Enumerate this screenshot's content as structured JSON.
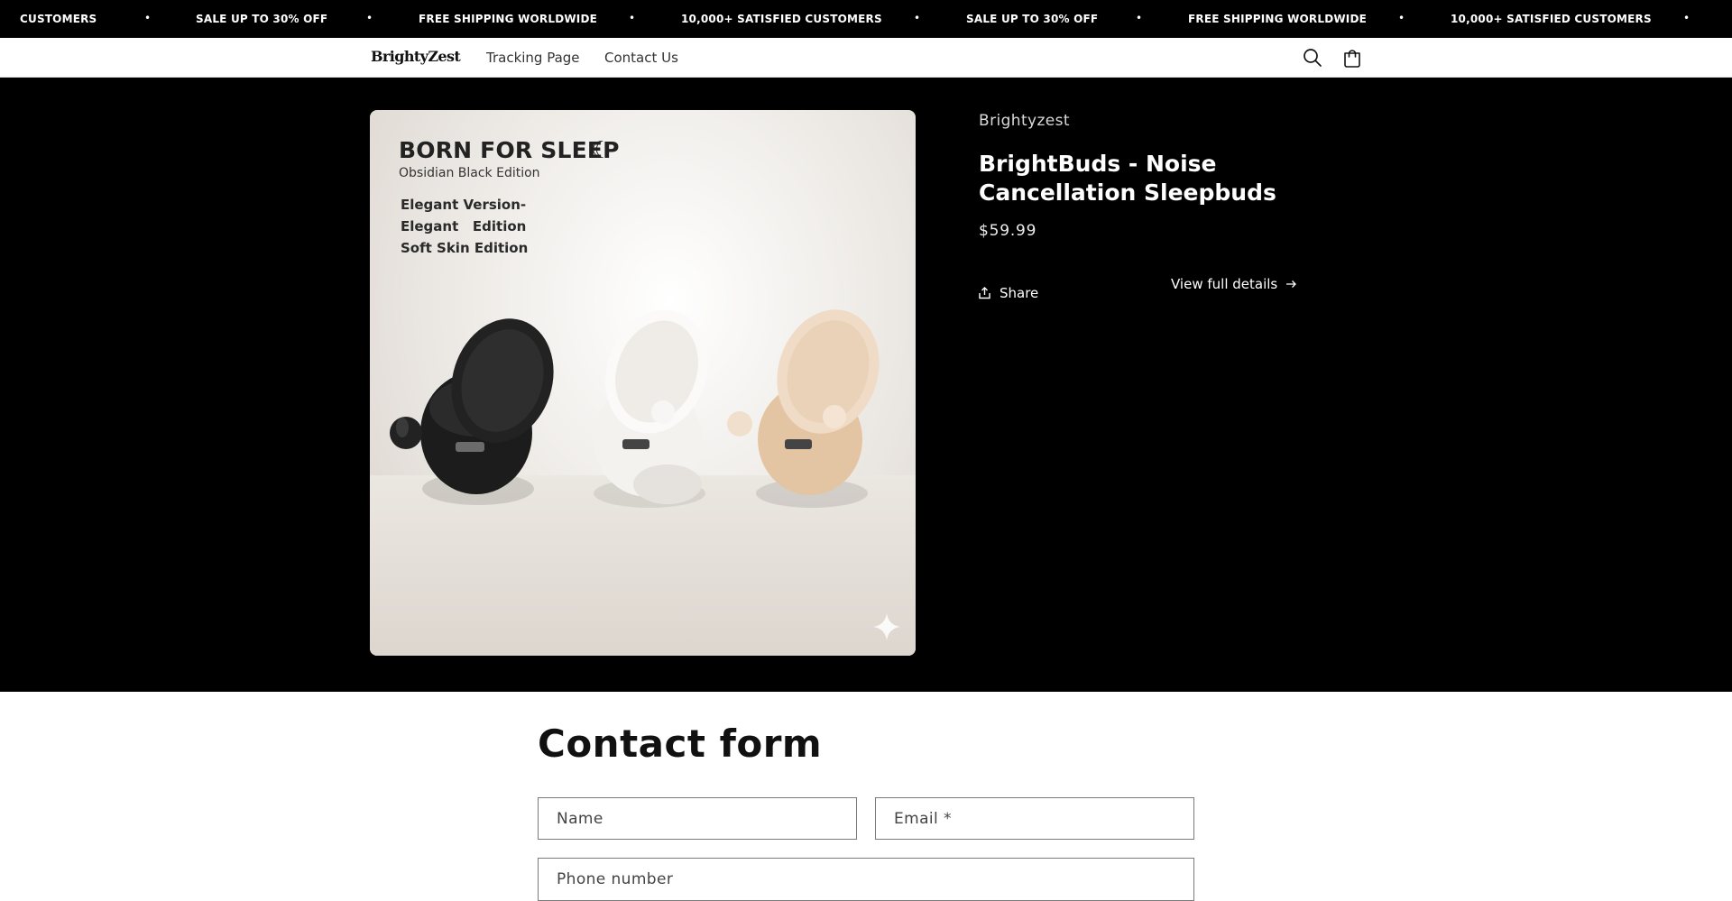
{
  "announcement": {
    "items": [
      "CUSTOMERS",
      "SALE UP TO 30% OFF",
      "FREE SHIPPING WORLDWIDE",
      "10,000+ SATISFIED CUSTOMERS",
      "SALE UP TO 30% OFF",
      "FREE SHIPPING WORLDWIDE",
      "10,000+ SATISFIED CUSTOMERS"
    ],
    "separator": "•"
  },
  "header": {
    "logo": "BrightyZest",
    "nav": [
      "Tracking Page",
      "Contact Us"
    ],
    "icons": [
      "search-icon",
      "cart-icon"
    ]
  },
  "product": {
    "vendor": "Brightyzest",
    "title": "BrightBuds - Noise Cancellation Sleepbuds",
    "price": "$59.99",
    "share_label": "Share",
    "view_details_label": "View full details",
    "image": {
      "headline": "BORN FOR SLEEP",
      "subheadline": "Obsidian Black Edition",
      "lines": [
        "Elegant Version-",
        "Elegant   Edition",
        "Soft Skin Edition"
      ],
      "case_colors": [
        "#1c1c1c",
        "#f2f0ee",
        "#e6c8a8"
      ]
    }
  },
  "contact_form": {
    "title": "Contact form",
    "name_placeholder": "Name",
    "email_placeholder": "Email *",
    "phone_placeholder": "Phone number"
  },
  "colors": {
    "hero_bg": "#000000",
    "page_bg": "#ffffff",
    "field_border": "#7a7a7a"
  }
}
